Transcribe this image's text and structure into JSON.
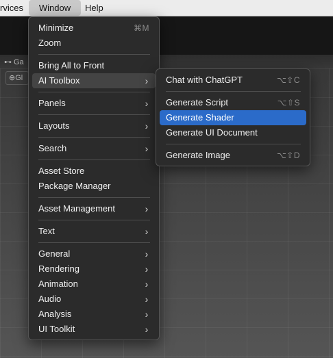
{
  "menubar": {
    "services": "rvices",
    "window": "Window",
    "help": "Help"
  },
  "editor": {
    "tab_label": "Ga",
    "toolbar_label": "Gl"
  },
  "window_menu": {
    "items": [
      {
        "label": "Minimize",
        "shortcut": "⌘M"
      },
      {
        "label": "Zoom"
      },
      {
        "label": "Bring All to Front"
      },
      {
        "label": "AI Toolbox"
      },
      {
        "label": "Panels"
      },
      {
        "label": "Layouts"
      },
      {
        "label": "Search"
      },
      {
        "label": "Asset Store"
      },
      {
        "label": "Package Manager"
      },
      {
        "label": "Asset Management"
      },
      {
        "label": "Text"
      },
      {
        "label": "General"
      },
      {
        "label": "Rendering"
      },
      {
        "label": "Animation"
      },
      {
        "label": "Audio"
      },
      {
        "label": "Analysis"
      },
      {
        "label": "UI Toolkit"
      }
    ]
  },
  "ai_toolbox_menu": {
    "items": [
      {
        "label": "Chat with ChatGPT",
        "shortcut": "⌥⇧C"
      },
      {
        "label": "Generate Script",
        "shortcut": "⌥⇧S"
      },
      {
        "label": "Generate Shader"
      },
      {
        "label": "Generate UI Document"
      },
      {
        "label": "Generate Image",
        "shortcut": "⌥⇧D"
      }
    ]
  },
  "colors": {
    "highlight": "#2b6bc9",
    "menu_bg": "#2b2b2b",
    "menubar_bg": "#ececec"
  }
}
